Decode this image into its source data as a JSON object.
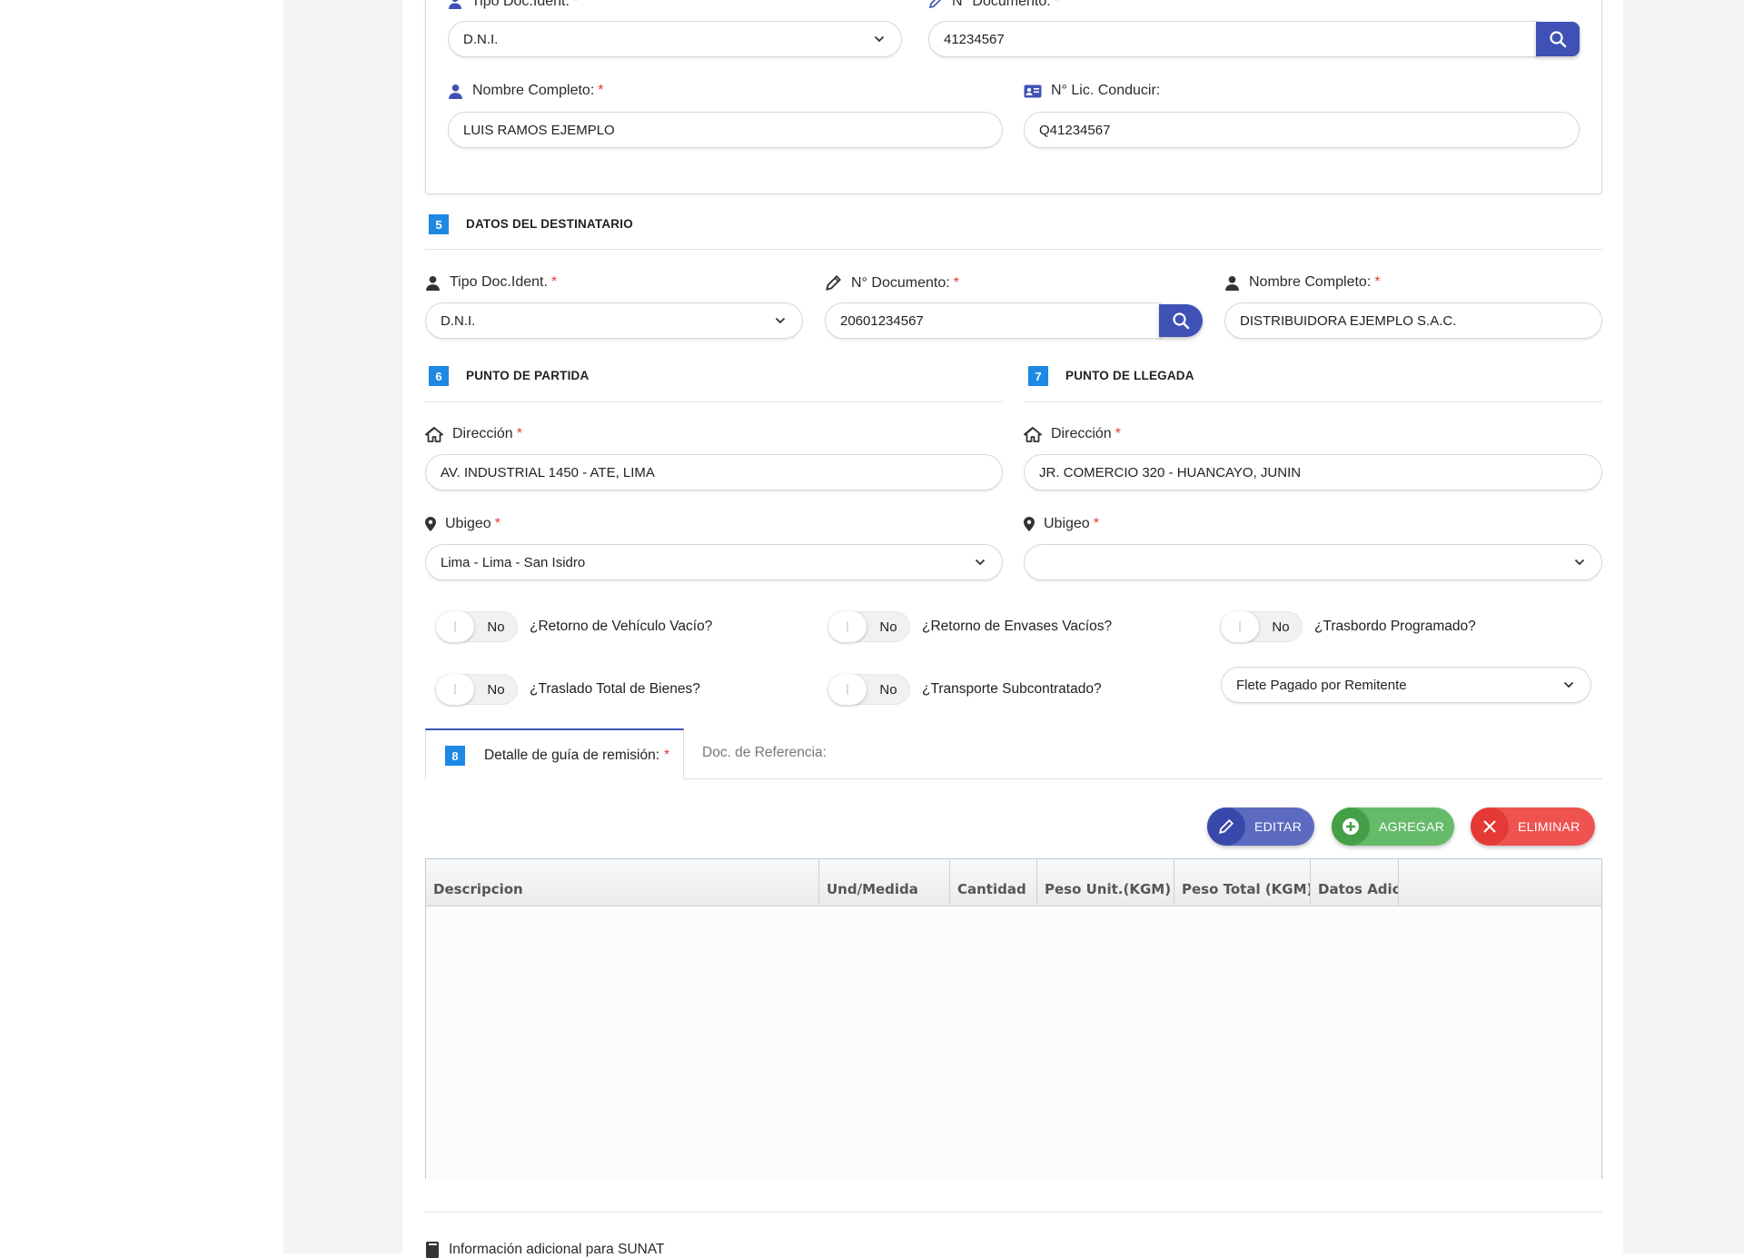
{
  "conductor": {
    "tipo_doc_label": "Tipo Doc.Ident.",
    "tipo_doc_value": "D.N.I.",
    "num_doc_label": "N° Documento:",
    "num_doc_value": "41234567",
    "nombre_label": "Nombre Completo:",
    "nombre_value": "LUIS RAMOS EJEMPLO",
    "licencia_label": "N° Lic. Conducir:",
    "licencia_value": "Q41234567"
  },
  "destinatario": {
    "num": "5",
    "title": "DATOS DEL DESTINATARIO",
    "tipo_doc_label": "Tipo Doc.Ident.",
    "tipo_doc_value": "D.N.I.",
    "num_doc_label": "N° Documento:",
    "num_doc_value": "20601234567",
    "nombre_label": "Nombre Completo:",
    "nombre_value": "DISTRIBUIDORA EJEMPLO S.A.C."
  },
  "partida": {
    "num": "6",
    "title": "PUNTO DE PARTIDA",
    "direccion_label": "Dirección",
    "direccion_value": "AV. INDUSTRIAL 1450 - ATE, LIMA",
    "ubigeo_label": "Ubigeo",
    "ubigeo_value": "Lima - Lima - San Isidro"
  },
  "llegada": {
    "num": "7",
    "title": "PUNTO DE LLEGADA",
    "direccion_label": "Dirección",
    "direccion_value": "JR. COMERCIO 320 - HUANCAYO, JUNIN",
    "ubigeo_label": "Ubigeo",
    "ubigeo_value": ""
  },
  "required_mark": "*",
  "toggles": [
    {
      "state": "No",
      "question": "¿Retorno de Vehículo Vacío?"
    },
    {
      "state": "No",
      "question": "¿Retorno de Envases Vacíos?"
    },
    {
      "state": "No",
      "question": "¿Trasbordo Programado?"
    },
    {
      "state": "No",
      "question": "¿Traslado Total de Bienes?"
    },
    {
      "state": "No",
      "question": "¿Transporte Subcontratado?"
    }
  ],
  "flete_value": "Flete Pagado por Remitente",
  "tabs": {
    "num": "8",
    "detalle_label": "Detalle de guía de remisión:",
    "referencia_label": "Doc. de Referencia:"
  },
  "buttons": {
    "editar": "EDITAR",
    "agregar": "AGREGAR",
    "eliminar": "ELIMINAR"
  },
  "table": {
    "columns": [
      "Descripcion",
      "Und/Medida",
      "Cantidad",
      "Peso Unit.(KGM)",
      "Peso Total (KGM)",
      "Datos Adic"
    ],
    "rows": []
  },
  "footer_text": "Información adicional para SUNAT",
  "colors": {
    "primary": "#3f51b5",
    "section_badge": "#1e88e5",
    "success": "#43a047",
    "danger": "#e53935",
    "required": "#e53935"
  }
}
